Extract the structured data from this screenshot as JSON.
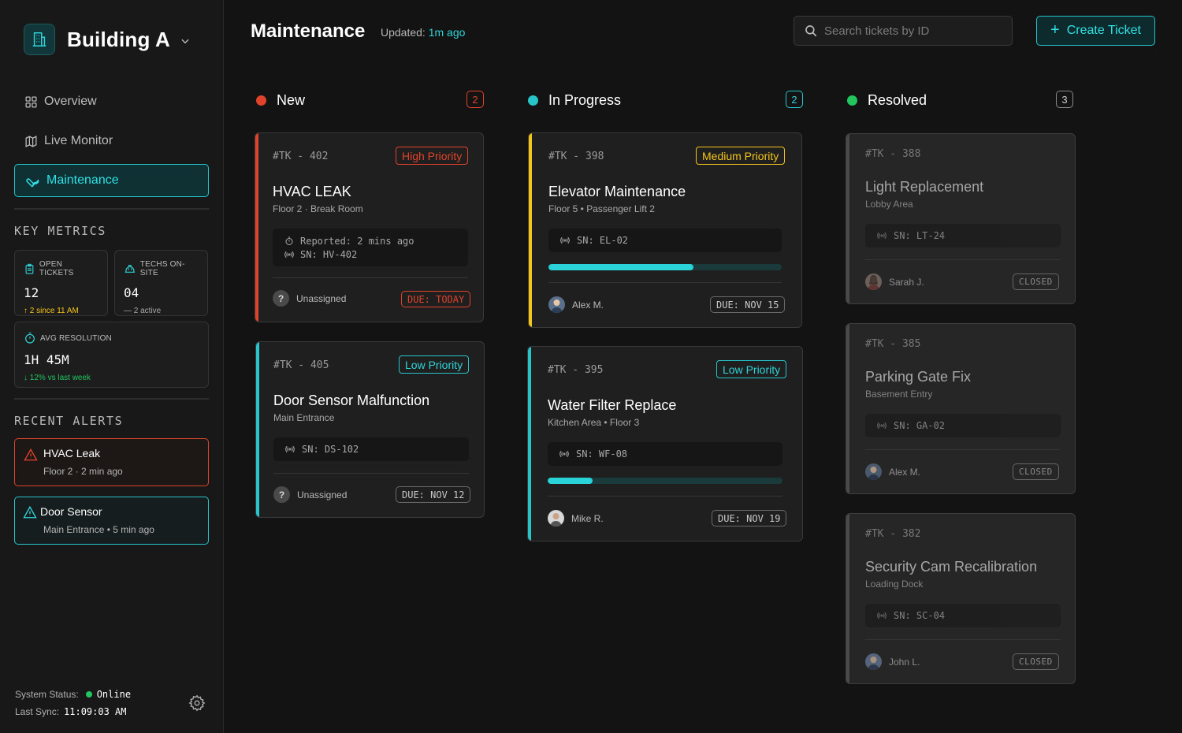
{
  "sidebar": {
    "building": "Building A",
    "nav": [
      {
        "label": "Overview",
        "icon": "grid-icon"
      },
      {
        "label": "Live Monitor",
        "icon": "map-icon"
      },
      {
        "label": "Maintenance",
        "icon": "wrench-icon",
        "active": true
      }
    ],
    "metrics_title": "KEY METRICS",
    "metrics": {
      "open": {
        "label": "OPEN TICKETS",
        "value": "12",
        "sub": "↑ 2 since 11 AM"
      },
      "techs": {
        "label": "TECHS ON-SITE",
        "value": "04",
        "sub": "— 2 active"
      },
      "avg": {
        "label": "AVG RESOLUTION",
        "value": "1H 45M",
        "sub": "↓ 12% vs last week"
      }
    },
    "alerts_title": "RECENT ALERTS",
    "alerts": [
      {
        "title": "HVAC Leak",
        "sub": "Floor 2 · 2 min ago"
      },
      {
        "title": "Door Sensor",
        "sub": "Main Entrance • 5 min ago"
      }
    ],
    "status_label": "System Status:",
    "status_value": "Online",
    "sync_label": "Last Sync:",
    "sync_value": "11:09:03 AM"
  },
  "header": {
    "title": "Maintenance",
    "updated_label": "Updated:",
    "updated_value": "1m ago",
    "search_placeholder": "Search tickets by ID",
    "create_label": "Create Ticket"
  },
  "columns": {
    "new": {
      "title": "New",
      "count": "2",
      "color": "#e0432b"
    },
    "progress": {
      "title": "In Progress",
      "count": "2",
      "color": "#27c5c9"
    },
    "resolved": {
      "title": "Resolved",
      "count": "3",
      "color": "#22c55e"
    }
  },
  "cards": {
    "c402": {
      "id": "#TK - 402",
      "priority": "High Priority",
      "title": "HVAC LEAK",
      "loc": "Floor 2 · Break Room",
      "reported": "Reported: 2 mins ago",
      "sn": "SN: HV-402",
      "assignee": "Unassigned",
      "due": "DUE: TODAY"
    },
    "c405": {
      "id": "#TK - 405",
      "priority": "Low Priority",
      "title": "Door Sensor Malfunction",
      "loc": "Main Entrance",
      "sn": "SN: DS-102",
      "assignee": "Unassigned",
      "due": "DUE: NOV 12"
    },
    "c398": {
      "id": "#TK - 398",
      "priority": "Medium Priority",
      "title": "Elevator Maintenance",
      "loc": "Floor 5 • Passenger Lift 2",
      "sn": "SN: EL-02",
      "progress": 0.62,
      "assignee": "Alex M.",
      "due": "DUE: NOV 15"
    },
    "c395": {
      "id": "#TK - 395",
      "priority": "Low Priority",
      "title": "Water Filter Replace",
      "loc": "Kitchen Area • Floor 3",
      "sn": "SN: WF-08",
      "progress": 0.19,
      "assignee": "Mike R.",
      "due": "DUE: NOV 19"
    },
    "c388": {
      "id": "#TK - 388",
      "title": "Light Replacement",
      "loc": "Lobby Area",
      "sn": "SN: LT-24",
      "assignee": "Sarah J.",
      "status": "CLOSED"
    },
    "c385": {
      "id": "#TK - 385",
      "title": "Parking Gate Fix",
      "loc": "Basement Entry",
      "sn": "SN: GA-02",
      "assignee": "Alex M.",
      "status": "CLOSED"
    },
    "c382": {
      "id": "#TK - 382",
      "title": "Security Cam Recalibration",
      "loc": "Loading Dock",
      "sn": "SN: SC-04",
      "assignee": "John L.",
      "status": "CLOSED"
    }
  }
}
